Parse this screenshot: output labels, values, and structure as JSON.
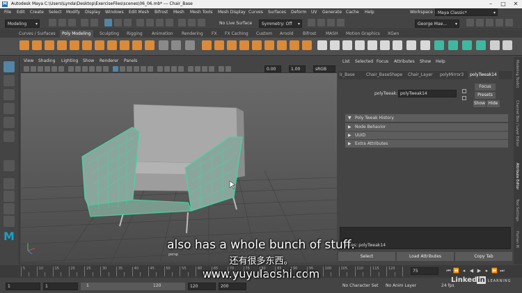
{
  "titlebar": {
    "title": "Autodesk Maya  C:\\Users\\Lynda\\Desktop\\ExerciseFiles\\scenes\\06_06.mb*   ---   Chair_Base"
  },
  "menubar": {
    "items": [
      "File",
      "Edit",
      "Create",
      "Select",
      "Modify",
      "Display",
      "Windows",
      "Edit Mesh",
      "Bifrost",
      "Mesh",
      "Mesh Tools",
      "Mesh Display",
      "Curves",
      "Surfaces",
      "Deform",
      "UV",
      "Generate",
      "Cache",
      "Help"
    ],
    "workspace_label": "Workspace :",
    "workspace_value": "Maya Classic*"
  },
  "statusline": {
    "mode": "Modeling",
    "live_surface": "No Live Surface",
    "symmetry": "Symmetry: Off",
    "user": "George Mae..."
  },
  "shelf": {
    "tabs": [
      "Curves / Surfaces",
      "Poly Modeling",
      "Sculpting",
      "Rigging",
      "Animation",
      "Rendering",
      "FX",
      "FX Caching",
      "Custom",
      "Arnold",
      "Bifrost",
      "MASH",
      "Motion Graphics",
      "XGen"
    ]
  },
  "viewport": {
    "menu": [
      "View",
      "Shading",
      "Lighting",
      "Show",
      "Renderer",
      "Panels"
    ],
    "field_a": "0.00",
    "field_b": "1.00",
    "colorspace": "sRGB gam",
    "camera": "persp"
  },
  "attribute_editor": {
    "menu": [
      "List",
      "Selected",
      "Focus",
      "Attributes",
      "Show",
      "Help"
    ],
    "tabs": [
      "ir_Base",
      "Chair_BaseShape",
      "Chair_Layer",
      "polyMirror3",
      "polyTweak14"
    ],
    "node_label": "polyTweak:",
    "node_value": "polyTweak14",
    "focus": "Focus",
    "presets": "Presets",
    "show": "Show",
    "hide": "Hide",
    "sections": [
      "Poly Tweak History",
      "Node Behavior",
      "UUID",
      "Extra Attributes"
    ],
    "notes_label": "Notes:  polyTweak14",
    "select": "Select",
    "load_attributes": "Load Attributes",
    "copy_tab": "Copy Tab"
  },
  "side_tabs": [
    "Modeling Toolkit",
    "Channel Box / Layer Editor",
    "Attribute Editor",
    "Tool Settings",
    "Human IK"
  ],
  "timeline": {
    "ticks": [
      "5",
      "10",
      "15",
      "20",
      "25",
      "30",
      "35",
      "40",
      "45",
      "50",
      "55",
      "60",
      "65",
      "70",
      "75",
      "80",
      "85",
      "90",
      "95",
      "100",
      "105",
      "110",
      "115",
      "120"
    ],
    "current": "75"
  },
  "range": {
    "start": "1",
    "start2": "1",
    "range_start": "1",
    "range_end": "120",
    "end": "120",
    "end2": "200",
    "character_set": "No Character Set",
    "anim_layer": "No Anim Layer",
    "fps": "24 fps"
  },
  "overlay": {
    "subtitle_en": "also has a whole bunch of stuff.",
    "subtitle_zh": "还有很多东西。",
    "watermark": "www.yuyulaoshi.com",
    "brand_a": "Linked",
    "brand_b": "in",
    "brand_c": "LEARNING"
  },
  "colors": {
    "selection_accent": "#5285a6",
    "wire_selected": "#3fd8a0",
    "shelf_active": "#505050"
  }
}
